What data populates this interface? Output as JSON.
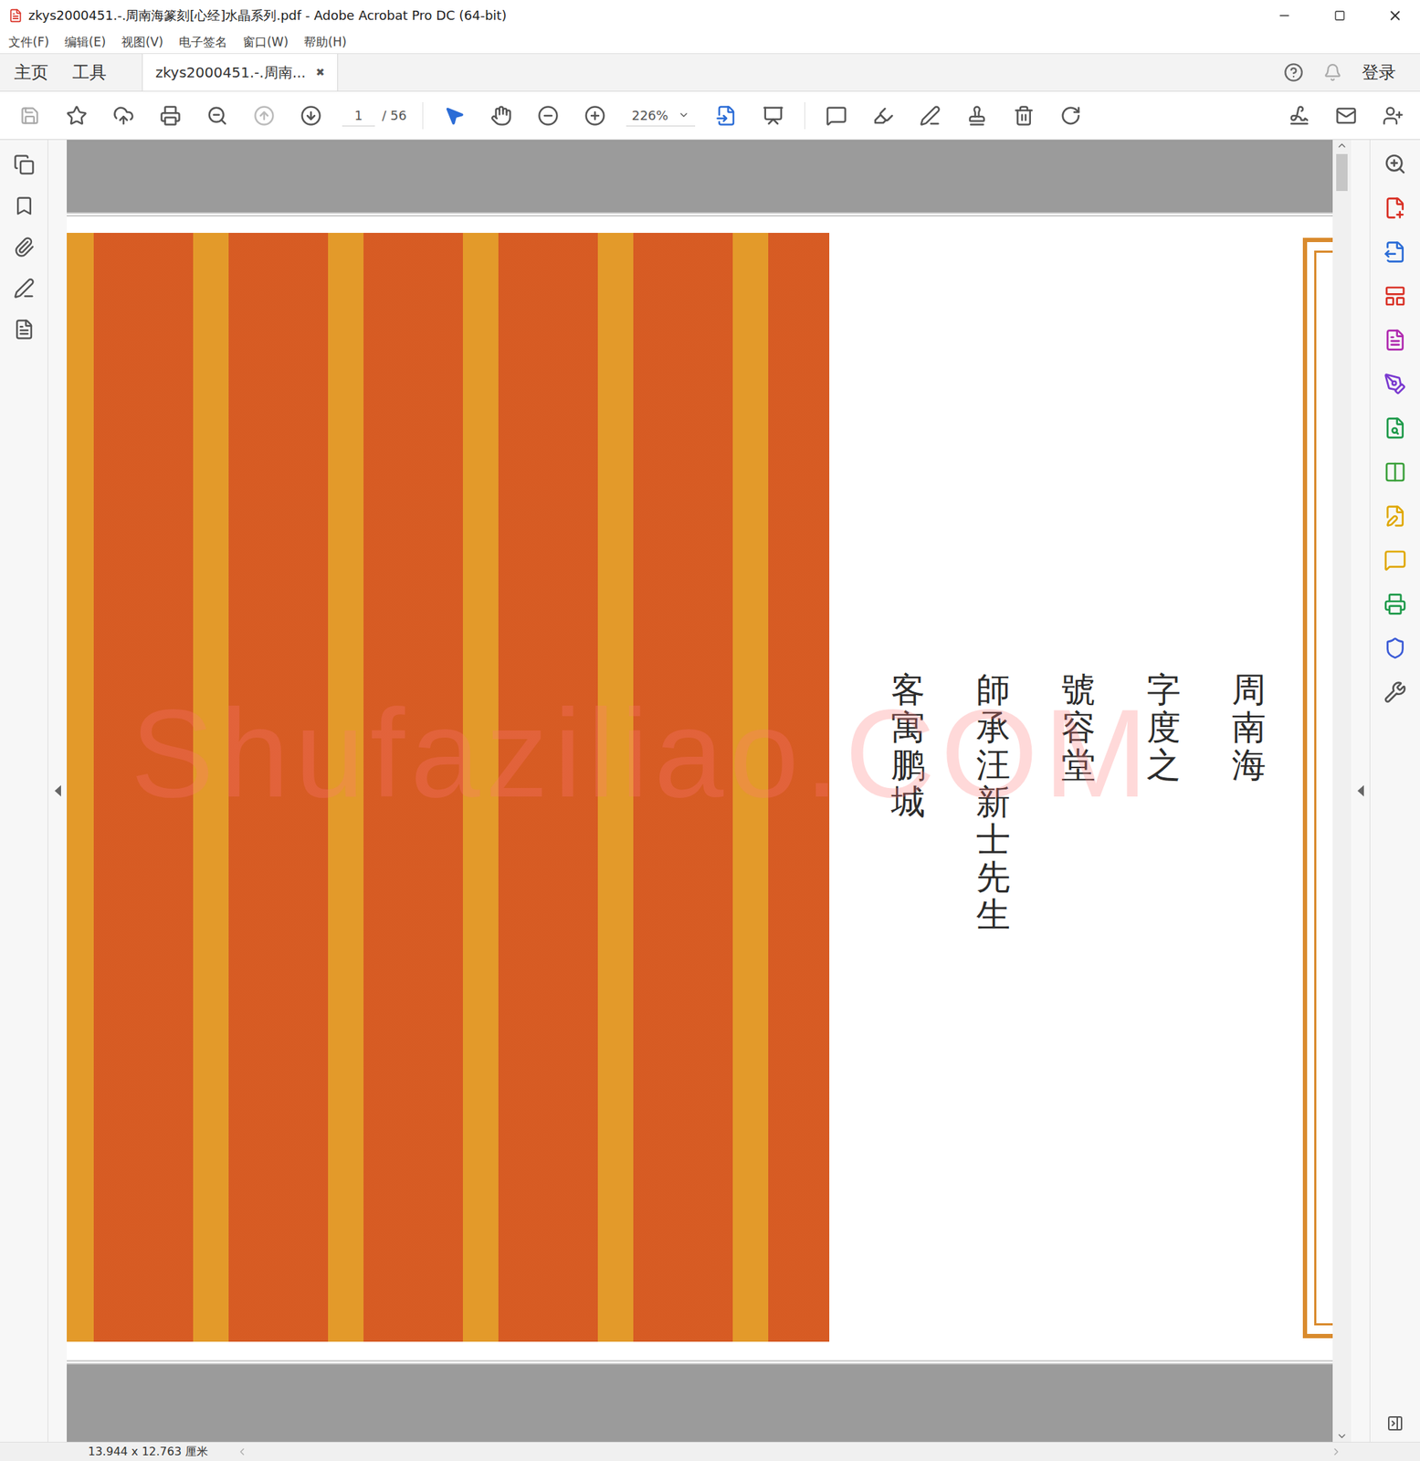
{
  "window": {
    "title": "zkys2000451.-.周南海篆刻[心经]水晶系列.pdf - Adobe Acrobat Pro DC (64-bit)"
  },
  "menu": [
    "文件(F)",
    "编辑(E)",
    "视图(V)",
    "电子签名",
    "窗口(W)",
    "帮助(H)"
  ],
  "tabs": [
    {
      "label": "主页",
      "selected": false,
      "close": ""
    },
    {
      "label": "工具",
      "selected": false,
      "close": ""
    },
    {
      "label": "zkys2000451.-.周南...",
      "selected": true,
      "close": "✖"
    }
  ],
  "account": {
    "label": "登录"
  },
  "toolbar": {
    "page": "1",
    "pages": "/ 56",
    "zoom": "226%"
  },
  "document": {
    "watermark": "Shufaziliao.COM",
    "columns": [
      "周南海",
      "字度之",
      "號容堂",
      "師承汪新士先生",
      "客寓鹏城"
    ]
  },
  "status_bar": {
    "size": "13.944 x 12.763 厘米"
  }
}
